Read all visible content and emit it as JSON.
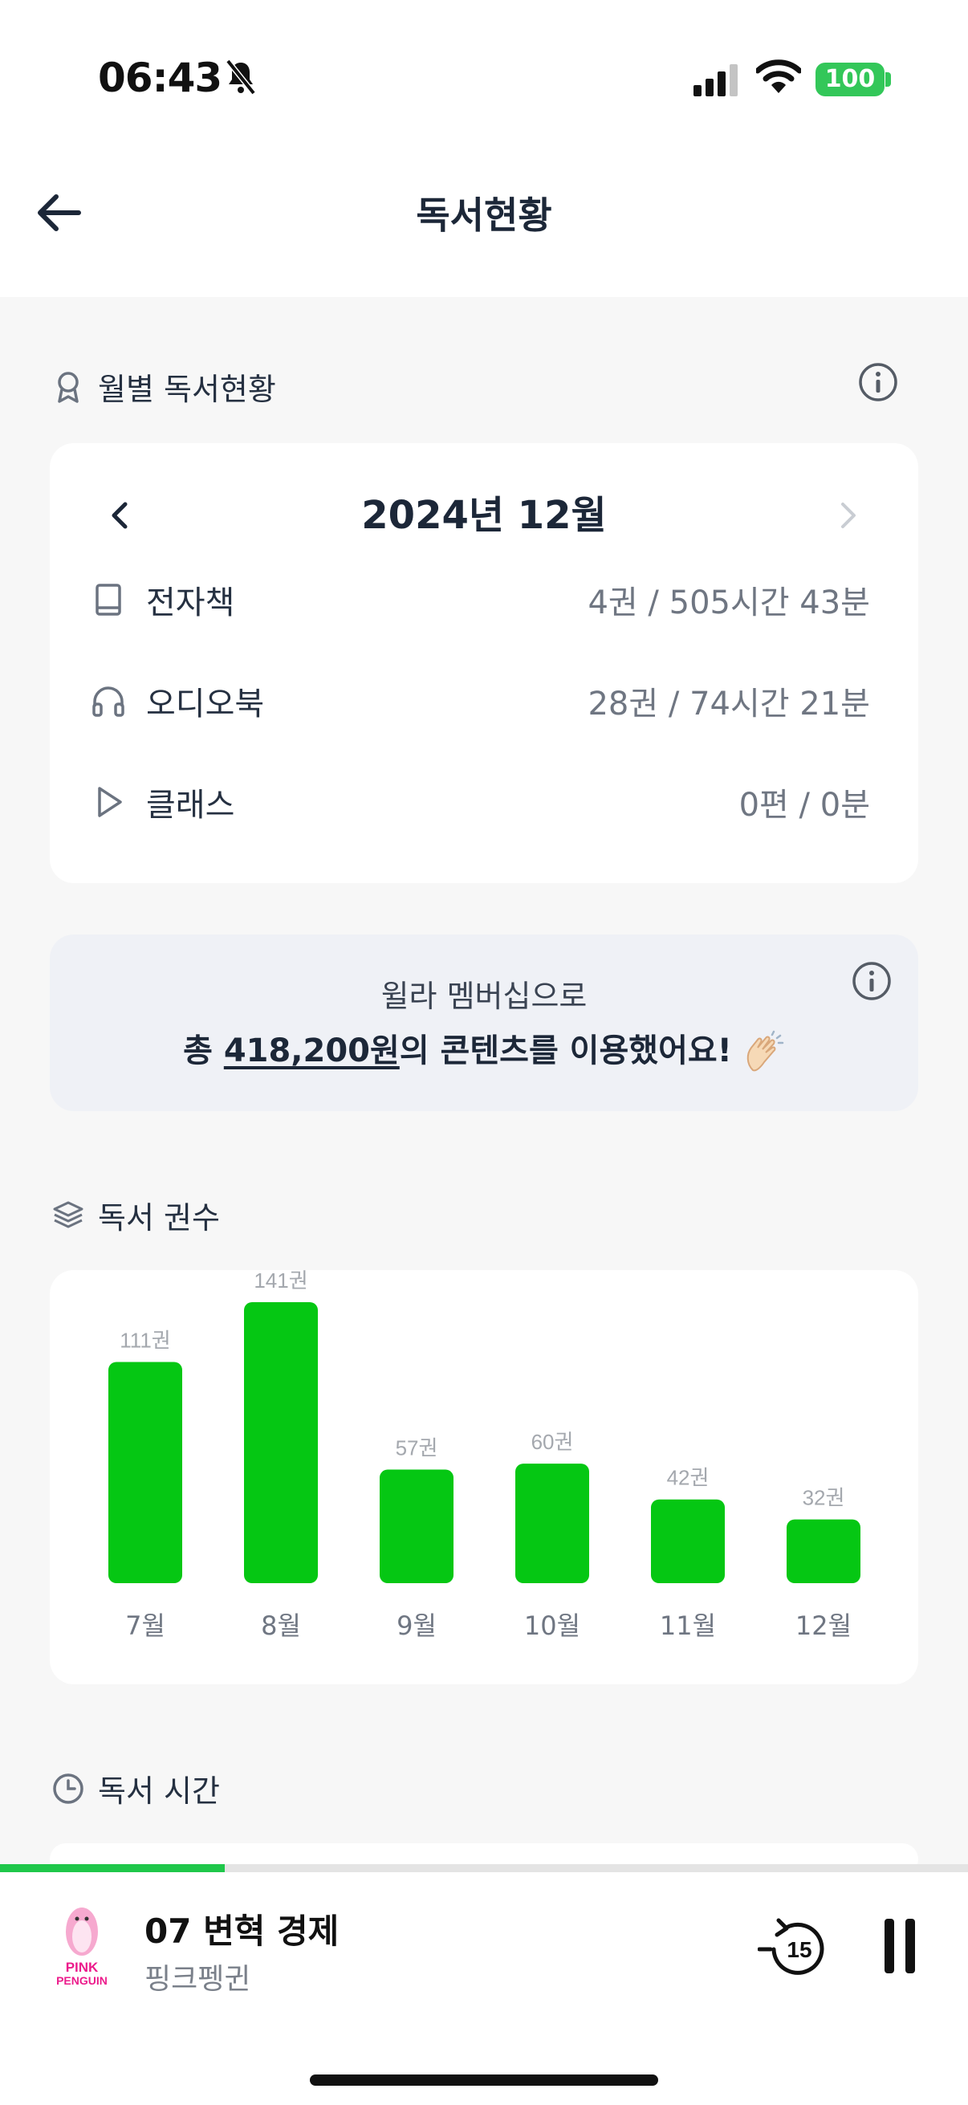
{
  "status_bar": {
    "time": "06:43",
    "battery": "100"
  },
  "header": {
    "title": "독서현황"
  },
  "monthly": {
    "section_title": "월별 독서현황",
    "month": "2024년 12월",
    "rows": [
      {
        "icon": "book-icon",
        "label": "전자책",
        "value": "4권 / 505시간 43분"
      },
      {
        "icon": "headphones-icon",
        "label": "오디오북",
        "value": "28권 / 74시간 21분"
      },
      {
        "icon": "play-icon",
        "label": "클래스",
        "value": "0편 / 0분"
      }
    ]
  },
  "banner": {
    "line1": "윌라 멤버십으로",
    "prefix": "총 ",
    "amount": "418,200원",
    "suffix": "의 콘텐츠를 이용했어요!"
  },
  "books_section": {
    "title": "독서 권수"
  },
  "time_section": {
    "title": "독서 시간"
  },
  "chart_data": {
    "type": "bar",
    "categories": [
      "7월",
      "8월",
      "9월",
      "10월",
      "11월",
      "12월"
    ],
    "values": [
      111,
      141,
      57,
      60,
      42,
      32
    ],
    "value_labels": [
      "111권",
      "141권",
      "57권",
      "60권",
      "42권",
      "32권"
    ],
    "color": "#05c713",
    "grid": false
  },
  "player": {
    "title": "07 변혁 경제",
    "artist": "핑크펭귄",
    "cover_text": "PINK PENGUIN",
    "rewind_label": "15",
    "progress_fraction": 0.232
  }
}
